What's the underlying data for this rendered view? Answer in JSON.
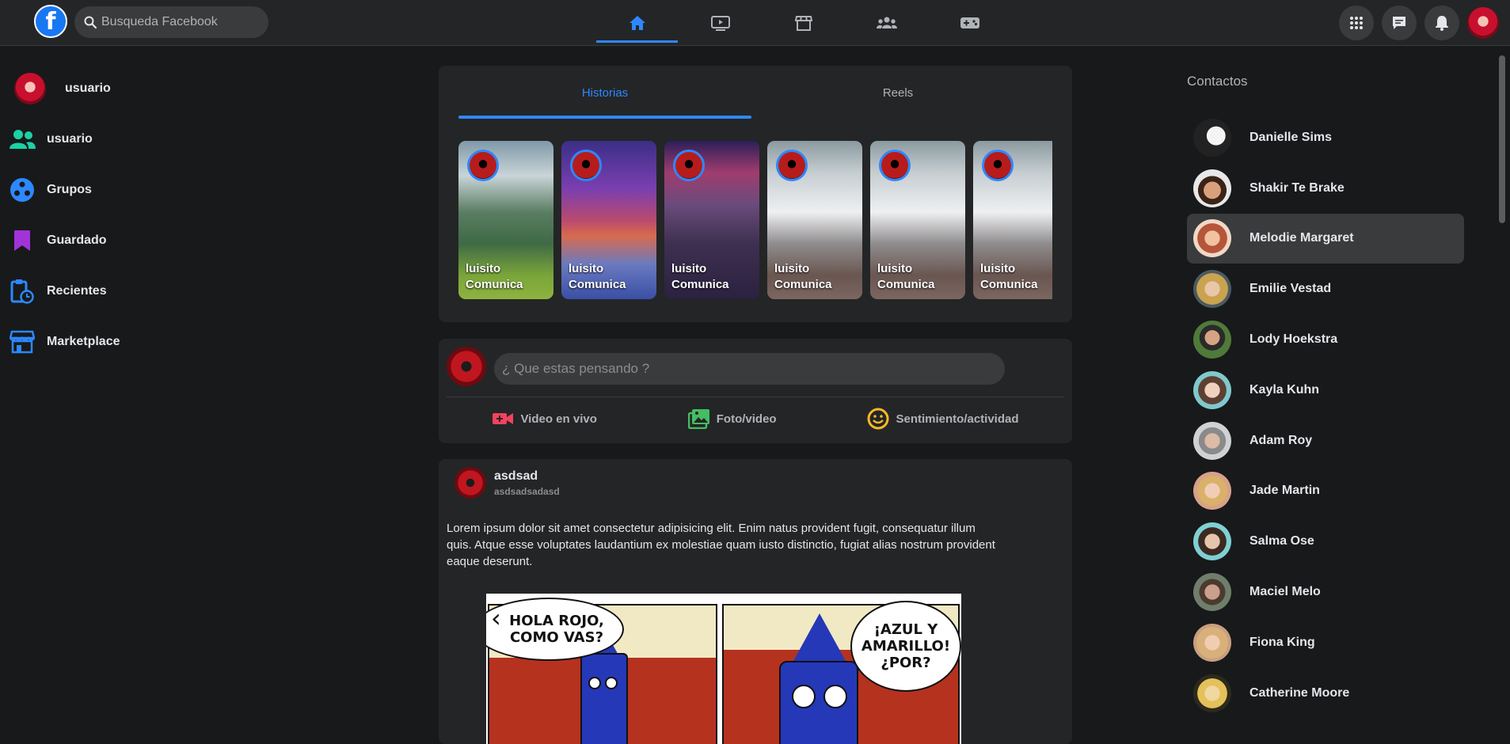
{
  "header": {
    "logo_letter": "f",
    "search_placeholder": "Busqueda Facebook",
    "nav_tabs": [
      {
        "icon": "home-icon",
        "active": true
      },
      {
        "icon": "watch-icon",
        "active": false
      },
      {
        "icon": "marketplace-icon",
        "active": false
      },
      {
        "icon": "groups-icon",
        "active": false
      },
      {
        "icon": "gaming-icon",
        "active": false
      }
    ],
    "right_buttons": [
      "menu-grid-icon",
      "messenger-icon",
      "notifications-icon",
      "profile-avatar"
    ]
  },
  "left_nav": {
    "profile_name": "usuario",
    "items": [
      {
        "label": "usuario",
        "icon": "friends-icon",
        "color": "#1bd1a5"
      },
      {
        "label": "Grupos",
        "icon": "groups-icon",
        "color": "#2d88ff"
      },
      {
        "label": "Guardado",
        "icon": "bookmark-icon",
        "color": "#a133d9"
      },
      {
        "label": "Recientes",
        "icon": "clipboard-clock-icon",
        "color": "#2d88ff"
      },
      {
        "label": "Marketplace",
        "icon": "marketplace-icon",
        "color": "#2d88ff"
      }
    ]
  },
  "stories": {
    "tabs": [
      "Historias",
      "Reels"
    ],
    "active_tab": "Historias",
    "items": [
      {
        "name": "luisito Comunica"
      },
      {
        "name": "luisito Comunica"
      },
      {
        "name": "luisito Comunica"
      },
      {
        "name": "luisito Comunica"
      },
      {
        "name": "luisito Comunica"
      },
      {
        "name": "luisito Comunica"
      }
    ]
  },
  "composer": {
    "placeholder": "¿ Que estas pensando ?",
    "actions": [
      {
        "label": "Video en vivo",
        "icon": "live-video-icon",
        "color": "#f3425f"
      },
      {
        "label": "Foto/video",
        "icon": "photo-icon",
        "color": "#45bd62"
      },
      {
        "label": "Sentimiento/actividad",
        "icon": "smiley-icon",
        "color": "#f7b928"
      }
    ]
  },
  "post": {
    "author": "asdsad",
    "subtitle": "asdsadsadasd",
    "text": "Lorem ipsum dolor sit amet consectetur adipisicing elit. Enim natus provident fugit, consequatur illum quis. Atque esse voluptates laudantium ex molestiae quam iusto distinctio, fugiat alias nostrum provident eaque deserunt.",
    "image_bubble_left": "HOLA ROJO, COMO VAS?",
    "image_bubble_right": "¡AZUL Y AMARILLO! ¿POR?"
  },
  "contacts": {
    "title": "Contactos",
    "items": [
      {
        "name": "Danielle Sims"
      },
      {
        "name": "Shakir Te Brake"
      },
      {
        "name": "Melodie Margaret",
        "highlighted": true
      },
      {
        "name": "Emilie Vestad"
      },
      {
        "name": "Lody Hoekstra"
      },
      {
        "name": "Kayla Kuhn"
      },
      {
        "name": "Adam Roy"
      },
      {
        "name": "Jade Martin"
      },
      {
        "name": "Salma Ose"
      },
      {
        "name": "Maciel Melo"
      },
      {
        "name": "Fiona King"
      },
      {
        "name": "Catherine Moore"
      }
    ]
  }
}
